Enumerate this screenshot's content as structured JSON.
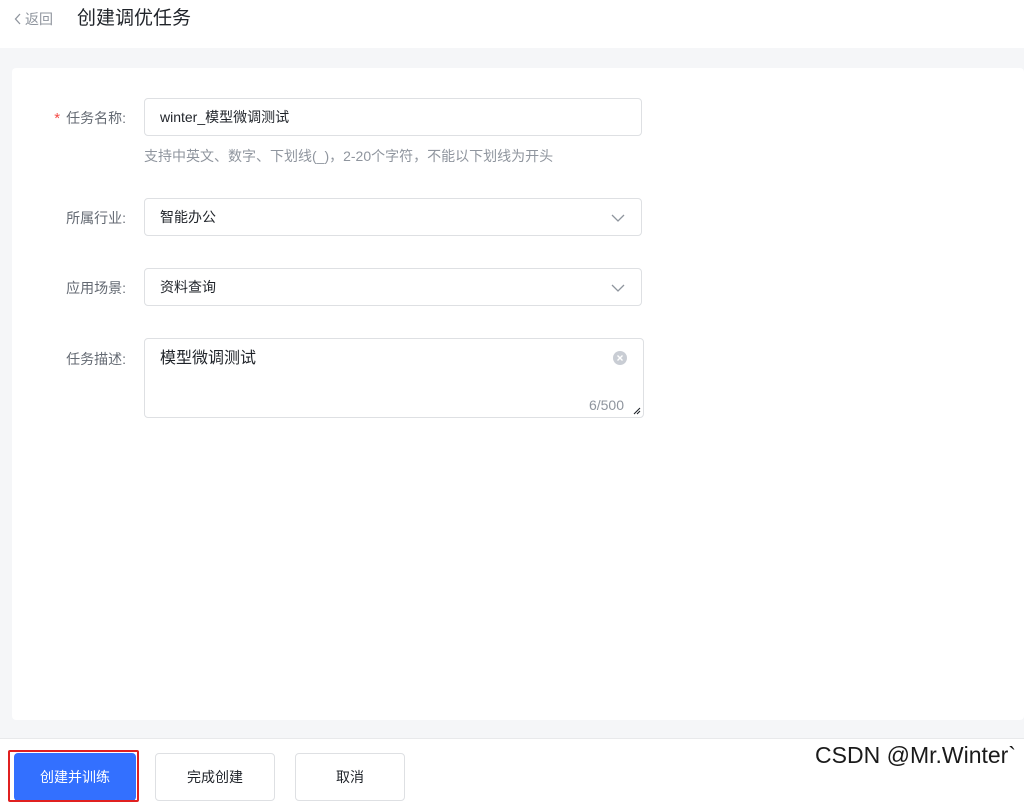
{
  "header": {
    "back_label": "返回",
    "title": "创建调优任务"
  },
  "form": {
    "task_name": {
      "label": "任务名称:",
      "required_mark": "*",
      "value": "winter_模型微调测试",
      "hint": "支持中英文、数字、下划线(_)，2-20个字符，不能以下划线为开头"
    },
    "industry": {
      "label": "所属行业:",
      "value": "智能办公"
    },
    "scenario": {
      "label": "应用场景:",
      "value": "资料查询"
    },
    "description": {
      "label": "任务描述:",
      "value": "模型微调测试",
      "counter": "6/500"
    }
  },
  "footer": {
    "create_and_train": "创建并训练",
    "finish_create": "完成创建",
    "cancel": "取消"
  },
  "watermark": "CSDN @Mr.Winter`",
  "colors": {
    "primary": "#3370ff",
    "required": "#f54a45",
    "highlight_border": "#e02020"
  },
  "icons": {
    "back": "chevron-left-icon",
    "select_arrow": "chevron-down-icon",
    "clear": "clear-circle-icon",
    "resize": "resize-handle-icon"
  }
}
